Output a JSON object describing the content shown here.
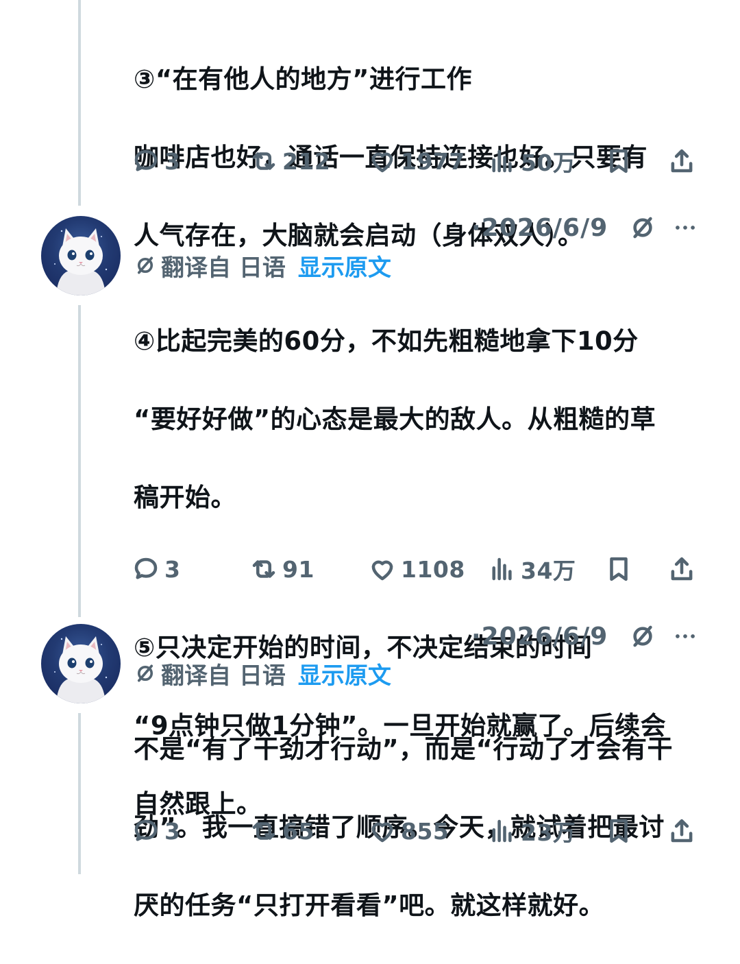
{
  "colors": {
    "text": "#0f1419",
    "secondary": "#536471",
    "link": "#1d9bf0",
    "thread_line": "#cfd9de"
  },
  "tweets": [
    {
      "text_lines": [
        "③“在有他人的地方”进行工作",
        "咖啡店也好，通话一直保持连接也好。只要有",
        "人气存在，大脑就会启动（身体双人）。"
      ],
      "replies": "3",
      "retweets": "212",
      "likes": "1977",
      "views": "50万"
    },
    {
      "date": "·2026/6/9",
      "translated_from": "翻译自 日语",
      "show_original": "显示原文",
      "text_lines": [
        "④比起完美的60分，不如先粗糙地拿下10分",
        "“要好好做”的心态是最大的敌人。从粗糙的草",
        "稿开始。",
        "",
        "⑤只决定开始的时间，不决定结束的时间",
        "“9点钟只做1分钟”。一旦开始就赢了。后续会",
        "自然跟上。"
      ],
      "replies": "3",
      "retweets": "91",
      "likes": "1108",
      "views": "34万"
    },
    {
      "date": "·2026/6/9",
      "translated_from": "翻译自 日语",
      "show_original": "显示原文",
      "text_lines": [
        "不是“有了干劲才行动”，而是“行动了才会有干",
        "劲”。我一直搞错了顺序。今天，就试着把最讨",
        "厌的任务“只打开看看”吧。就这样就好。"
      ],
      "replies": "3",
      "retweets": "65",
      "likes": "855",
      "views": "23万"
    }
  ],
  "icons": [
    "reply-icon",
    "retweet-icon",
    "like-icon",
    "views-icon",
    "bookmark-icon",
    "share-icon",
    "grok-icon",
    "more-icon",
    "translate-icon"
  ]
}
